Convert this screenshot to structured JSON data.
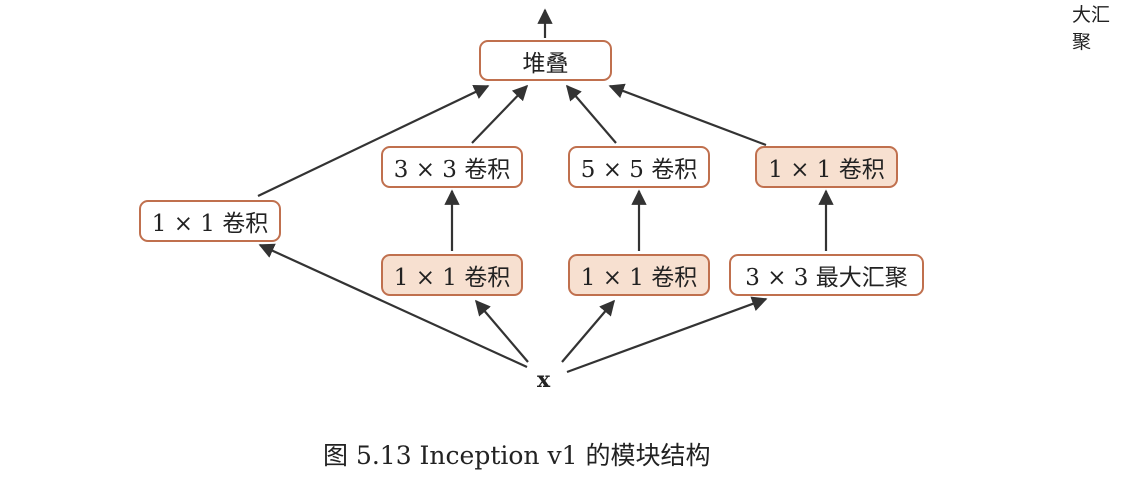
{
  "nodes": {
    "concat": "堆叠",
    "left_conv1x1": "1 × 1 卷积",
    "conv3x3": "3 × 3 卷积",
    "conv5x5": "5 × 5 卷积",
    "pool_proj": "1 × 1 卷积",
    "reduce3x3": "1 × 1 卷积",
    "reduce5x5": "1 × 1 卷积",
    "maxpool": "3 × 3 最大汇聚"
  },
  "input_label": "x",
  "caption": "图 5.13 Inception v1 的模块结构",
  "corner_text": "大汇聚"
}
